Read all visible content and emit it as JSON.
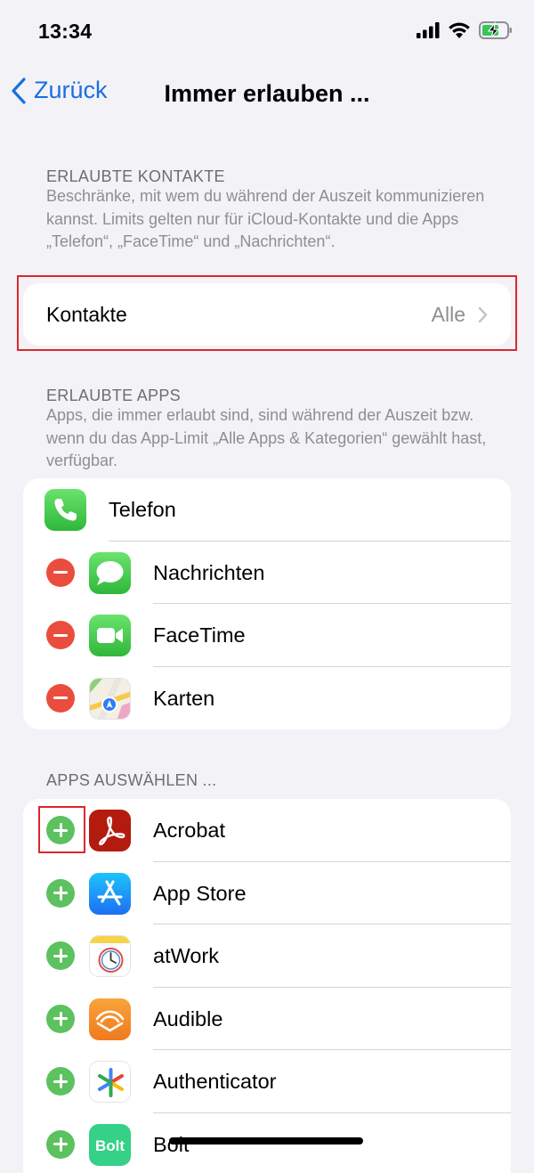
{
  "status": {
    "time": "13:34"
  },
  "nav": {
    "back_label": "Zurück",
    "title": "Immer erlauben ..."
  },
  "contacts_section": {
    "header": "ERLAUBTE KONTAKTE",
    "description": "Beschränke, mit wem du während der Auszeit kommunizieren kannst. Limits gelten nur für iCloud-Kontakte und die Apps „Telefon“, „FaceTime“ und „Nachrichten“.",
    "row_label": "Kontakte",
    "row_value": "Alle"
  },
  "allowed_apps_section": {
    "header": "ERLAUBTE APPS",
    "description": "Apps, die immer erlaubt sind, sind während der Auszeit bzw. wenn du das App-Limit „Alle Apps & Kategorien“ gewählt hast, verfügbar.",
    "apps": [
      {
        "name": "Telefon",
        "icon": "phone-icon"
      },
      {
        "name": "Nachrichten",
        "icon": "messages-icon"
      },
      {
        "name": "FaceTime",
        "icon": "facetime-icon"
      },
      {
        "name": "Karten",
        "icon": "maps-icon"
      }
    ]
  },
  "choose_apps_section": {
    "header": "APPS AUSWÄHLEN ...",
    "apps": [
      {
        "name": "Acrobat",
        "icon": "acrobat-icon"
      },
      {
        "name": "App Store",
        "icon": "app-store-icon"
      },
      {
        "name": "atWork",
        "icon": "atwork-icon"
      },
      {
        "name": "Audible",
        "icon": "audible-icon"
      },
      {
        "name": "Authenticator",
        "icon": "authenticator-icon"
      },
      {
        "name": "Bolt",
        "icon": "bolt-icon"
      }
    ]
  },
  "colors": {
    "accent": "#1a6fe0",
    "remove": "#ea4d3d",
    "add": "#5cc15f",
    "highlight": "#d9282f"
  }
}
